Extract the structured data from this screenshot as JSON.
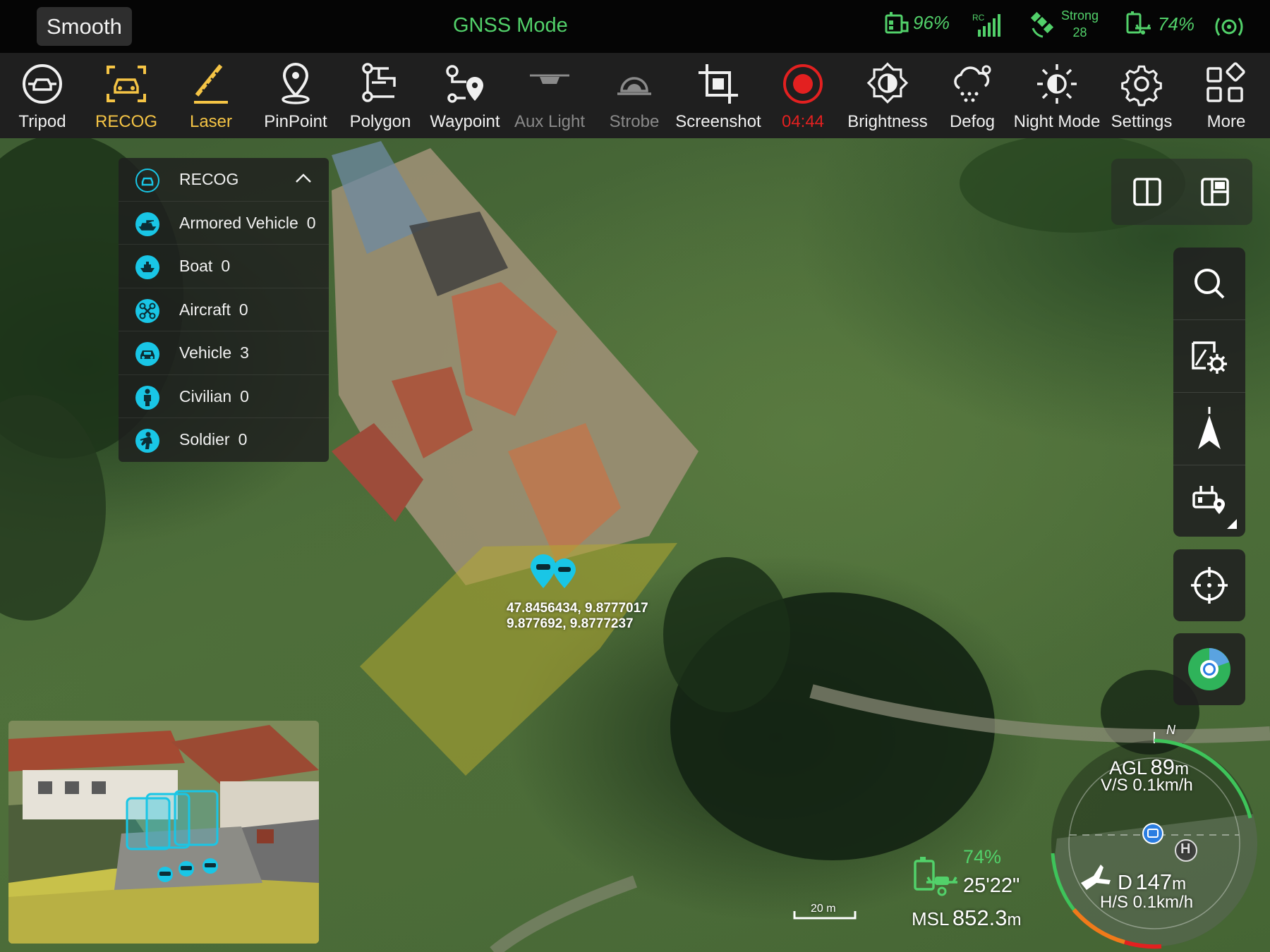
{
  "status_bar": {
    "flight_mode": "Smooth",
    "positioning_mode": "GNSS Mode",
    "rc_battery": "96%",
    "rc_signal_label": "RC",
    "gnss_strength": "Strong",
    "satellite_count": "28",
    "aircraft_battery": "74%"
  },
  "toolbar": {
    "tools": [
      {
        "label": "Tripod",
        "icon": "tripod-icon",
        "state": "normal"
      },
      {
        "label": "RECOG",
        "icon": "recog-icon",
        "state": "active"
      },
      {
        "label": "Laser",
        "icon": "laser-icon",
        "state": "active"
      },
      {
        "label": "PinPoint",
        "icon": "pinpoint-icon",
        "state": "normal"
      },
      {
        "label": "Polygon",
        "icon": "polygon-icon",
        "state": "normal"
      },
      {
        "label": "Waypoint",
        "icon": "waypoint-icon",
        "state": "normal"
      },
      {
        "label": "Aux Light",
        "icon": "aux-light-icon",
        "state": "disabled"
      },
      {
        "label": "Strobe",
        "icon": "strobe-icon",
        "state": "disabled"
      },
      {
        "label": "Screenshot",
        "icon": "screenshot-icon",
        "state": "normal"
      },
      {
        "label": "04:44",
        "icon": "record-icon",
        "state": "recording"
      },
      {
        "label": "Brightness",
        "icon": "brightness-icon",
        "state": "normal"
      },
      {
        "label": "Defog",
        "icon": "defog-icon",
        "state": "normal"
      },
      {
        "label": "Night Mode",
        "icon": "night-mode-icon",
        "state": "normal"
      },
      {
        "label": "Settings",
        "icon": "settings-icon",
        "state": "normal"
      },
      {
        "label": "More",
        "icon": "more-icon",
        "state": "normal"
      }
    ]
  },
  "recog_panel": {
    "title": "RECOG",
    "items": [
      {
        "label": "Armored Vehicle",
        "count": "0",
        "icon": "tank-icon"
      },
      {
        "label": "Boat",
        "count": "0",
        "icon": "boat-icon"
      },
      {
        "label": "Aircraft",
        "count": "0",
        "icon": "drone-icon"
      },
      {
        "label": "Vehicle",
        "count": "3",
        "icon": "car-icon"
      },
      {
        "label": "Civilian",
        "count": "0",
        "icon": "person-icon"
      },
      {
        "label": "Soldier",
        "count": "0",
        "icon": "soldier-icon"
      }
    ]
  },
  "map": {
    "target_coords_line1": "47.8456434, 9.8777017",
    "target_coords_line2": "9.877692, 9.8777237",
    "scale_label": "20 m"
  },
  "telemetry": {
    "agl_label": "AGL",
    "agl_value": "89",
    "agl_unit": "m",
    "vs_text": "V/S 0.1km/h",
    "distance_label": "D",
    "distance_value": "147",
    "distance_unit": "m",
    "hs_text": "H/S 0.1km/h",
    "compass_north": "N",
    "home_marker": "H",
    "battery_percent": "74%",
    "flight_time": "25'22\"",
    "msl_label": "MSL",
    "msl_value": "852.3",
    "msl_unit": "m"
  },
  "colors": {
    "accent_green": "#52d16a",
    "accent_yellow": "#f5c445",
    "recording_red": "#e32020",
    "recog_cyan": "#19c6e6"
  }
}
